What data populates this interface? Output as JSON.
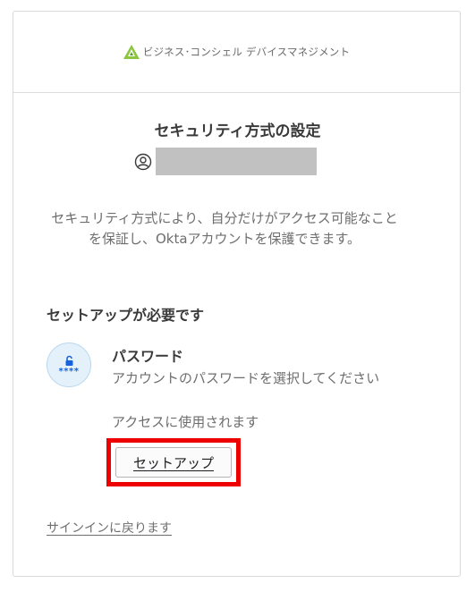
{
  "header": {
    "brand_text": "ビジネス･コンシェル デバイスマネジメント",
    "brand_logo": "green-triangle-logo"
  },
  "main": {
    "title": "セキュリティ方式の設定",
    "identifier_icon": "user-circle-icon",
    "description": "セキュリティ方式により、自分だけがアクセス可能なことを保証し、Oktaアカウントを保護できます。",
    "setup_heading": "セットアップが必要です"
  },
  "authenticator": {
    "icon": "password-lock-icon",
    "icon_text": "****",
    "title": "パスワード",
    "description": "アカウントのパスワードを選択してください",
    "note": "アクセスに使用されます",
    "button_label": "セットアップ"
  },
  "footer": {
    "back_link": "サインインに戻ります"
  },
  "colors": {
    "highlight": "#ee0000",
    "brand_green": "#8cc63f",
    "icon_blue": "#1662dd"
  }
}
